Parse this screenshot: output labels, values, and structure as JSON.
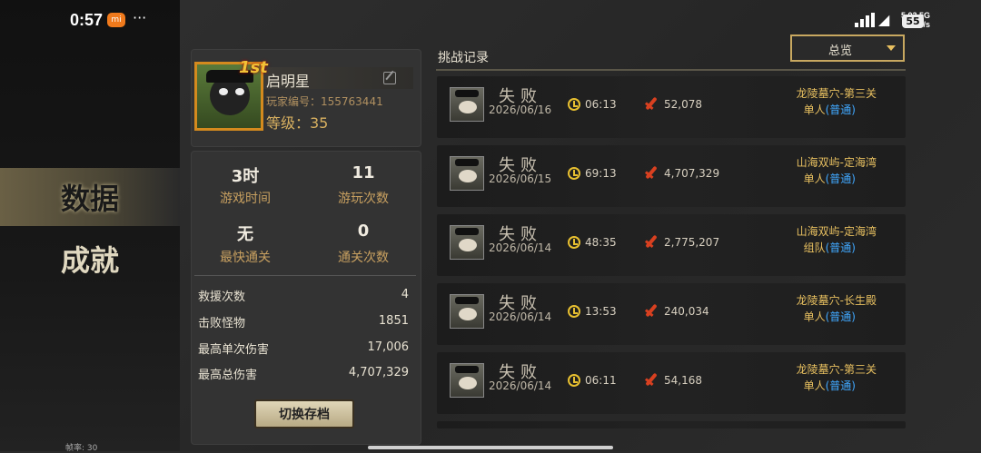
{
  "status": {
    "time": "0:57",
    "carrier_badge": "mi",
    "more": "···",
    "net_speed": "5.03",
    "net_unit": "KB/s",
    "net_type": "5G",
    "battery": "55"
  },
  "sidebar": {
    "items": [
      {
        "label": "数据",
        "active": true
      },
      {
        "label": "成就",
        "active": false
      }
    ],
    "fps": "帧率: 30"
  },
  "profile": {
    "rank_badge": "1st",
    "name": "启明星",
    "player_id": "玩家编号：155763441",
    "level": "等级：35"
  },
  "stats": {
    "play_time_value": "3时",
    "play_time_label": "游戏时间",
    "play_count_value": "11",
    "play_count_label": "游玩次数",
    "fastest_value": "无",
    "fastest_label": "最快通关",
    "clear_count_value": "0",
    "clear_count_label": "通关次数",
    "details": [
      {
        "label": "救援次数",
        "value": "4"
      },
      {
        "label": "击败怪物",
        "value": "1851"
      },
      {
        "label": "最高单次伤害",
        "value": "17,006"
      },
      {
        "label": "最高总伤害",
        "value": "4,707,329"
      }
    ],
    "switch_button": "切换存档"
  },
  "records": {
    "title": "挑战记录",
    "filter": "总览",
    "items": [
      {
        "result": "失败",
        "date": "2026/06/16",
        "time": "06:13",
        "damage": "52,078",
        "stage": "龙陵墓穴-第三关",
        "mode": "单人",
        "difficulty": "(普通)"
      },
      {
        "result": "失败",
        "date": "2026/06/15",
        "time": "69:13",
        "damage": "4,707,329",
        "stage": "山海双屿-定海湾",
        "mode": "单人",
        "difficulty": "(普通)"
      },
      {
        "result": "失败",
        "date": "2026/06/14",
        "time": "48:35",
        "damage": "2,775,207",
        "stage": "山海双屿-定海湾",
        "mode": "组队",
        "difficulty": "(普通)"
      },
      {
        "result": "失败",
        "date": "2026/06/14",
        "time": "13:53",
        "damage": "240,034",
        "stage": "龙陵墓穴-长生殿",
        "mode": "单人",
        "difficulty": "(普通)"
      },
      {
        "result": "失败",
        "date": "2026/06/14",
        "time": "06:11",
        "damage": "54,168",
        "stage": "龙陵墓穴-第三关",
        "mode": "单人",
        "difficulty": "(普通)"
      }
    ]
  }
}
